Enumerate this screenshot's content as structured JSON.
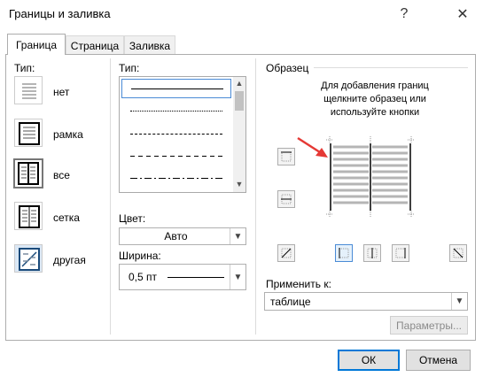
{
  "window": {
    "title": "Границы и заливка",
    "help_glyph": "?",
    "close_glyph": "✕"
  },
  "tabs": [
    {
      "label": "Граница",
      "active": true
    },
    {
      "label": "Страница",
      "active": false
    },
    {
      "label": "Заливка",
      "active": false
    }
  ],
  "setting": {
    "label": "Тип:",
    "items": [
      {
        "label": "нет",
        "selected": false
      },
      {
        "label": "рамка",
        "selected": false
      },
      {
        "label": "все",
        "selected": true
      },
      {
        "label": "сетка",
        "selected": false
      },
      {
        "label": "другая",
        "selected": false
      }
    ]
  },
  "style": {
    "label": "Тип:",
    "color_label": "Цвет:",
    "color_value": "Авто",
    "width_label": "Ширина:",
    "width_value": "0,5 пт"
  },
  "preview": {
    "group_label": "Образец",
    "hint_line1": "Для добавления границ",
    "hint_line2": "щелкните образец или",
    "hint_line3": "используйте кнопки"
  },
  "apply_to": {
    "label": "Применить к:",
    "value": "таблице"
  },
  "buttons": {
    "options": "Параметры...",
    "ok": "ОК",
    "cancel": "Отмена"
  },
  "colors": {
    "accent": "#0078d7",
    "arrow": "#e53935"
  }
}
